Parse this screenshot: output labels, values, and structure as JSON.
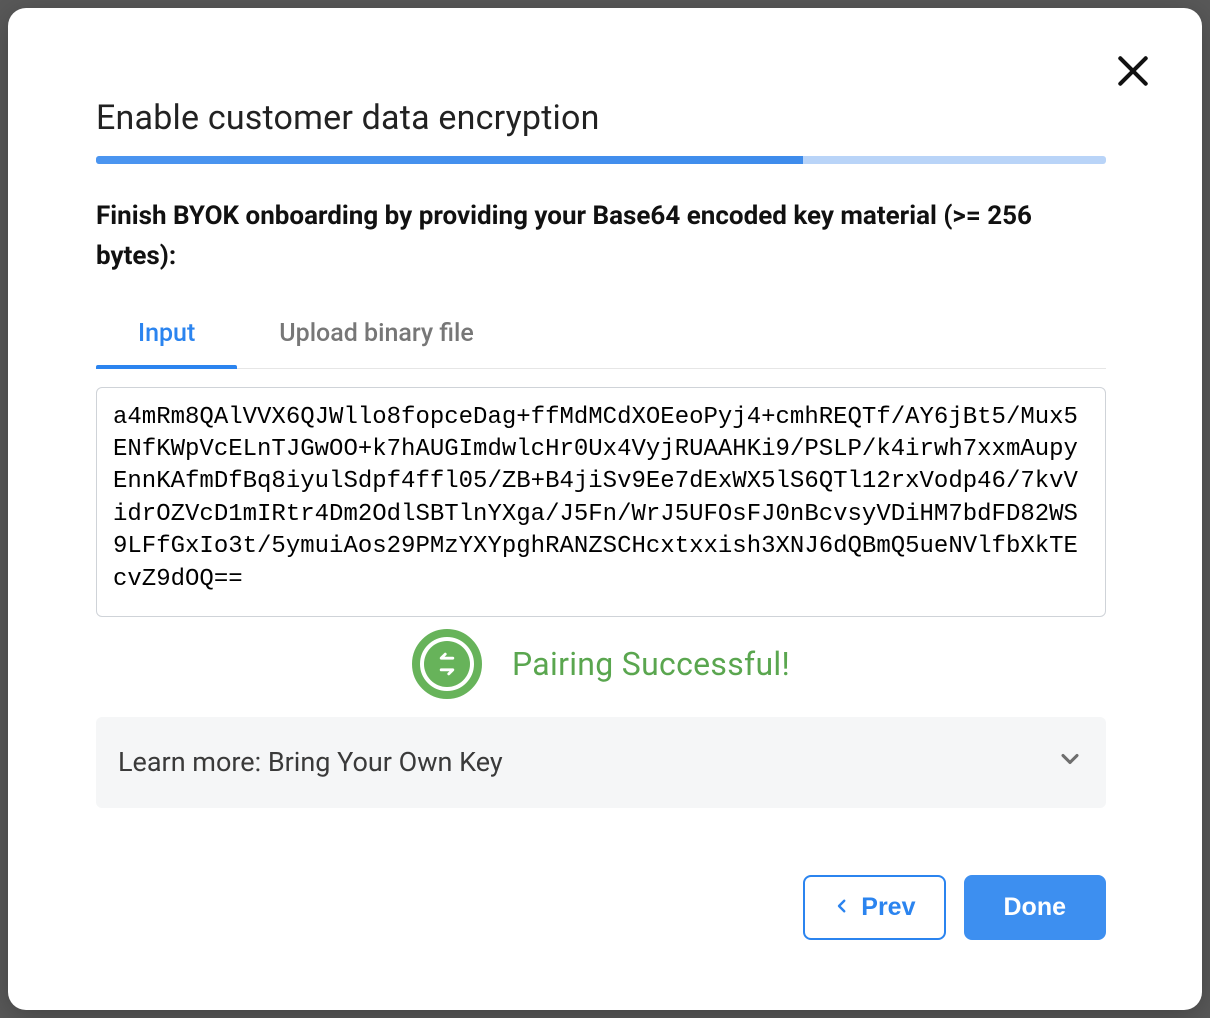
{
  "modal": {
    "title": "Enable customer data encryption",
    "progress_percent": 70,
    "instruction": "Finish BYOK onboarding by providing your Base64 encoded key material (>= 256 bytes):",
    "tabs": [
      {
        "id": "input",
        "label": "Input",
        "active": true
      },
      {
        "id": "upload",
        "label": "Upload binary file",
        "active": false
      }
    ],
    "key_textarea": {
      "value": "a4mRm8QAlVVX6QJWllo8fopceDag+ffMdMCdXOEeoPyj4+cmhREQTf/AY6jBt5/Mux5ENfKWpVcELnTJGwOO+k7hAUGImdwlcHr0Ux4VyjRUAAHKi9/PSLP/k4irwh7xxmAupyEnnKAfmDfBq8iyulSdpf4ffl05/ZB+B4jiSv9Ee7dExWX5lS6QTl12rxVodp46/7kvVidrOZVcD1mIRtr4Dm2OdlSBTlnYXga/J5Fn/WrJ5UFOsFJ0nBcvsyVDiHM7bdFD82WS9LFfGxIo3t/5ymuiAos29PMzYXYpghRANZSCHcxtxxish3XNJ6dQBmQ5ueNVlfbXkTEcvZ9dOQ=="
    },
    "status": {
      "icon": "pairing-success-icon",
      "text": "Pairing Successful!",
      "color": "#5aa64f"
    },
    "learn_more": {
      "label": "Learn more: Bring Your Own Key"
    },
    "buttons": {
      "prev": "Prev",
      "done": "Done"
    }
  }
}
